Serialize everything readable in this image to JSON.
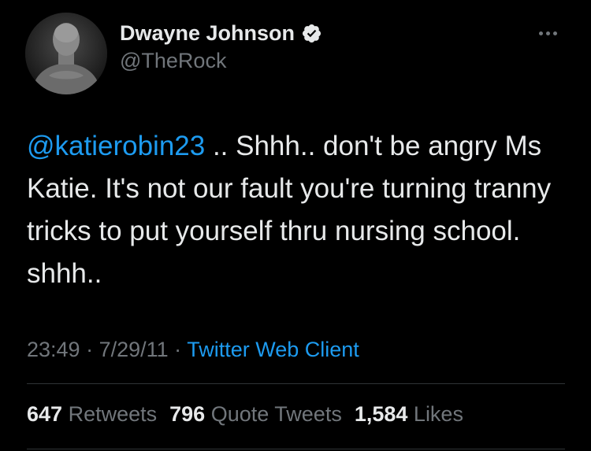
{
  "author": {
    "display_name": "Dwayne Johnson",
    "handle": "@TheRock",
    "verified": true,
    "avatar_icon": "avatar-photo",
    "verified_icon": "verified-badge-icon"
  },
  "menu": {
    "more_icon": "more-dots-icon"
  },
  "tweet": {
    "mention": "@katierobin23",
    "text": " .. Shhh.. don't be angry Ms Katie. It's not our fault you're turning tranny tricks to put yourself thru nursing school. shhh.."
  },
  "meta": {
    "time": "23:49",
    "separator1": " · ",
    "date": "7/29/11",
    "separator2": " · ",
    "source": "Twitter Web Client"
  },
  "stats": {
    "retweets_count": "647",
    "retweets_label": "Retweets",
    "quotes_count": "796",
    "quotes_label": "Quote Tweets",
    "likes_count": "1,584",
    "likes_label": "Likes"
  },
  "colors": {
    "background": "#000000",
    "text": "#e7e9ea",
    "secondary": "#71767b",
    "link": "#1d9bf0",
    "divider": "#2f3336"
  }
}
